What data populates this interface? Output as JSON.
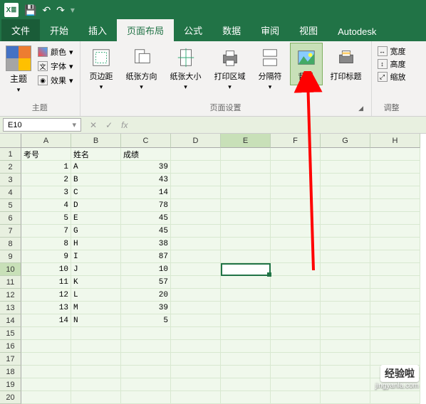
{
  "titlebar": {
    "icons": [
      "save-icon",
      "undo-icon",
      "redo-icon"
    ]
  },
  "menu": {
    "file": "文件",
    "tabs": [
      "开始",
      "插入",
      "页面布局",
      "公式",
      "数据",
      "审阅",
      "视图",
      "Autodesk"
    ],
    "active_index": 2
  },
  "ribbon": {
    "theme": {
      "label": "主题",
      "main": "主题",
      "color": "颜色",
      "font": "字体",
      "effect": "效果"
    },
    "page_setup": {
      "label": "页面设置",
      "margins": "页边距",
      "orientation": "纸张方向",
      "size": "纸张大小",
      "print_area": "打印区域",
      "breaks": "分隔符",
      "background": "背景",
      "print_titles": "打印标题"
    },
    "adjust": {
      "label": "调整",
      "width": "宽度",
      "height": "高度",
      "scale": "缩放"
    }
  },
  "namebox": "E10",
  "columns": [
    "A",
    "B",
    "C",
    "D",
    "E",
    "F",
    "G",
    "H"
  ],
  "row_count": 20,
  "selected_cell": {
    "row": 10,
    "col": 4
  },
  "headers": {
    "c0": "考号",
    "c1": "姓名",
    "c2": "成绩"
  },
  "rows": [
    {
      "num": "1",
      "name": "A",
      "score": "39"
    },
    {
      "num": "2",
      "name": "B",
      "score": "43"
    },
    {
      "num": "3",
      "name": "C",
      "score": "14"
    },
    {
      "num": "4",
      "name": "D",
      "score": "78"
    },
    {
      "num": "5",
      "name": "E",
      "score": "45"
    },
    {
      "num": "7",
      "name": "G",
      "score": "45"
    },
    {
      "num": "8",
      "name": "H",
      "score": "38"
    },
    {
      "num": "9",
      "name": "I",
      "score": "87"
    },
    {
      "num": "10",
      "name": "J",
      "score": "10"
    },
    {
      "num": "11",
      "name": "K",
      "score": "57"
    },
    {
      "num": "12",
      "name": "L",
      "score": "20"
    },
    {
      "num": "13",
      "name": "M",
      "score": "39"
    },
    {
      "num": "14",
      "name": "N",
      "score": "5"
    }
  ],
  "watermark": {
    "top": "经验啦",
    "bottom": "jingyanla.com"
  }
}
